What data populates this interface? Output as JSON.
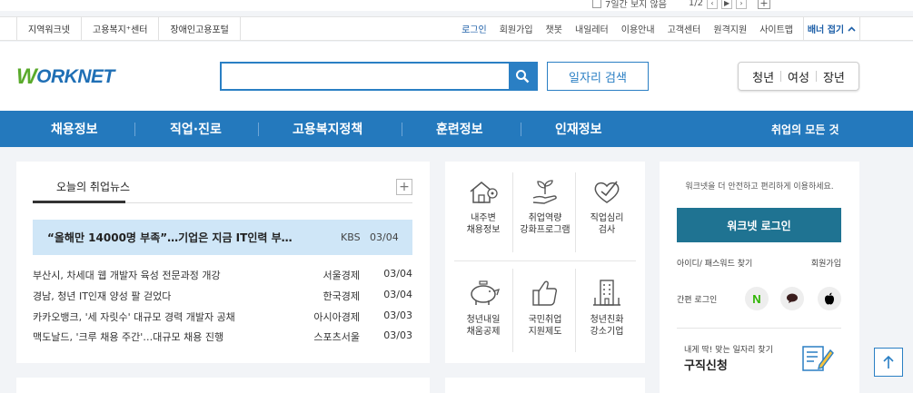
{
  "banner": {
    "checkbox_label": "7일간 보지 않음",
    "page_indicator": "1/2",
    "prev_icon": "chevron-left-icon",
    "play_icon": "play-icon",
    "next_icon": "chevron-right-icon",
    "add_symbol": "+"
  },
  "util": {
    "left_links": [
      "지역워크넷",
      "고용복지⁺센터",
      "장애인고용포털"
    ],
    "right_links": [
      "로그인",
      "회원가입",
      "챗봇",
      "내일레터",
      "이용안내",
      "고객센터",
      "원격지원",
      "사이트맵"
    ],
    "banner_toggle": "배너 접기"
  },
  "header": {
    "logo_text": "ORKNET",
    "logo_w": "W",
    "search_placeholder": "",
    "search_icon": "search-icon",
    "job_search_label": "일자리 검색",
    "target_links": [
      "청년",
      "여성",
      "장년"
    ]
  },
  "gnb": {
    "items": [
      "채용정보",
      "직업·진로",
      "고용복지정책",
      "훈련정보",
      "인재정보"
    ],
    "right_item": "취업의 모든 것"
  },
  "news": {
    "tab": "오늘의 취업뉴스",
    "more": "+",
    "headline": {
      "title": "“올해만 14000명 부족”…기업은 지금 IT인력 부…",
      "source": "KBS",
      "date": "03/04"
    },
    "rows": [
      {
        "title": "부산시, 차세대 웹 개발자 육성 전문과정 개강",
        "source": "서울경제",
        "date": "03/04"
      },
      {
        "title": "경남, 청년 IT인재 양성 팔 걷었다",
        "source": "한국경제",
        "date": "03/04"
      },
      {
        "title": "카카오뱅크, '세 자릿수' 대규모 경력 개발자 공채",
        "source": "아시아경제",
        "date": "03/03"
      },
      {
        "title": "맥도날드, '크루 채용 주간'…대규모 채용 진행",
        "source": "스포츠서울",
        "date": "03/03"
      }
    ]
  },
  "quick": {
    "items": [
      {
        "line1": "내주변",
        "line2": "채용정보",
        "icon": "house-location-icon"
      },
      {
        "line1": "취업역량",
        "line2": "강화프로그램",
        "icon": "sprout-hand-icon"
      },
      {
        "line1": "직업심리",
        "line2": "검사",
        "icon": "heart-check-icon"
      },
      {
        "line1": "청년내일",
        "line2": "채움공제",
        "icon": "piggy-bank-icon"
      },
      {
        "line1": "국민취업",
        "line2": "지원제도",
        "icon": "thumbs-up-icon"
      },
      {
        "line1": "청년친화",
        "line2": "강소기업",
        "icon": "building-icon"
      }
    ]
  },
  "login": {
    "message": "워크넷을 더 안전하고 편리하게 이용하세요.",
    "button": "워크넷 로그인",
    "find": "아이디/ 패스워드 찾기",
    "join": "회원가입",
    "easy_login": "간편 로그인",
    "sns": [
      {
        "icon": "naver-icon",
        "glyph": "N",
        "color": "#2db400"
      },
      {
        "icon": "kakao-icon",
        "glyph": "●",
        "color": "#3a1d1d"
      },
      {
        "icon": "apple-icon",
        "glyph": "●",
        "color": "#000000"
      }
    ],
    "apply_sub": "내게 딱! 맞는 일자리 찾기",
    "apply_main": "구직신청"
  },
  "colors": {
    "brand_blue": "#2479bd",
    "login_btn": "#1f7392",
    "headline_bg": "#cfe6f7"
  }
}
